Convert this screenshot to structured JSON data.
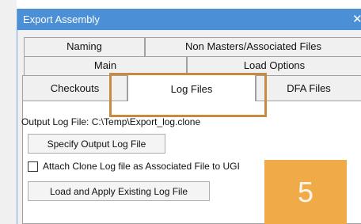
{
  "dialog": {
    "title": "Export Assembly",
    "close_glyph": "✕"
  },
  "tabs": {
    "row1": [
      "Naming",
      "Non Masters/Associated Files"
    ],
    "row2": [
      "Main",
      "Load Options"
    ],
    "row3": [
      "Checkouts",
      "Log Files",
      "DFA Files"
    ],
    "active": "Log Files"
  },
  "log_files": {
    "output_label": "Output Log File: C:\\Temp\\Export_log.clone",
    "specify_button": "Specify Output Log File",
    "attach_label": "Attach Clone Log file as Associated File to UGI",
    "attach_checked": false,
    "load_button": "Load and Apply Existing Log File"
  },
  "overlay": {
    "step_number": "5",
    "highlight_color": "#c78a3f",
    "badge_color": "#f0ab48"
  },
  "colors": {
    "titlebar": "#4b8fd6",
    "dialog_bg": "#f0f0f0"
  }
}
